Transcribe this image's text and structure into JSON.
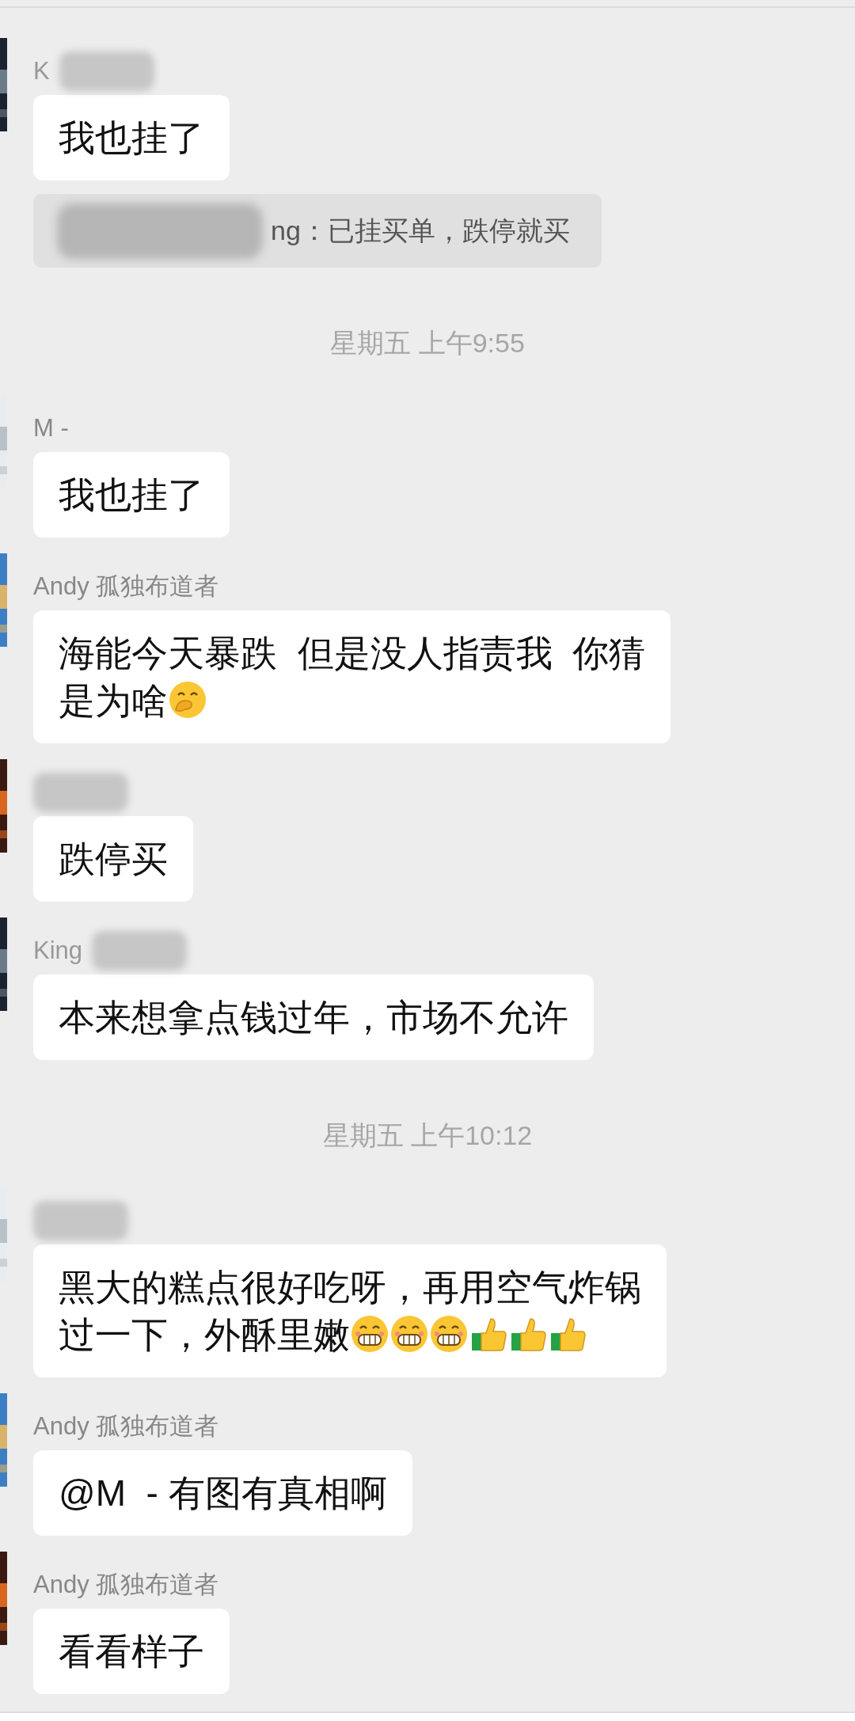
{
  "messages": [
    {
      "kind": "message",
      "sender": "K",
      "sender_redacted": true,
      "avatar": {
        "kind": "picture"
      },
      "text": "我也挂了"
    },
    {
      "kind": "quote",
      "sender_redacted": true,
      "text": "ng：已挂买单，跌停就买"
    },
    {
      "kind": "time",
      "text": "星期五 上午9:55"
    },
    {
      "kind": "message",
      "sender": "M -",
      "sender_redacted": false,
      "avatar": {
        "kind": "picture"
      },
      "text": "我也挂了"
    },
    {
      "kind": "message",
      "sender": "Andy 孤独布道者",
      "sender_redacted": false,
      "avatar": {
        "kind": "picture"
      },
      "lines": [
        "海能今天暴跌  但是没人指责我  你猜",
        "是为啥"
      ],
      "emoji": [
        {
          "kind": "hand_over_mouth"
        }
      ]
    },
    {
      "kind": "message",
      "sender_redacted": true,
      "avatar": {
        "kind": "picture"
      },
      "text": "跌停买"
    },
    {
      "kind": "message",
      "sender": "King",
      "sender_redacted": true,
      "avatar": {
        "kind": "picture"
      },
      "text": "本来想拿点钱过年，市场不允许"
    },
    {
      "kind": "time",
      "text": "星期五 上午10:12"
    },
    {
      "kind": "message",
      "sender_redacted": true,
      "avatar": {
        "kind": "picture"
      },
      "lines": [
        "黑大的糕点很好吃呀，再用空气炸锅",
        "过一下，外酥里嫩"
      ],
      "emoji": [
        {
          "kind": "grin"
        },
        {
          "kind": "grin"
        },
        {
          "kind": "grin"
        },
        {
          "kind": "thumbs_up"
        },
        {
          "kind": "thumbs_up"
        },
        {
          "kind": "thumbs_up"
        }
      ]
    },
    {
      "kind": "message",
      "sender": "Andy 孤独布道者",
      "sender_redacted": false,
      "avatar": {
        "kind": "picture"
      },
      "text": "@M  - 有图有真相啊"
    },
    {
      "kind": "message",
      "sender": "Andy 孤独布道者",
      "sender_redacted": false,
      "avatar": {
        "kind": "picture"
      },
      "text": "看看样子"
    }
  ]
}
